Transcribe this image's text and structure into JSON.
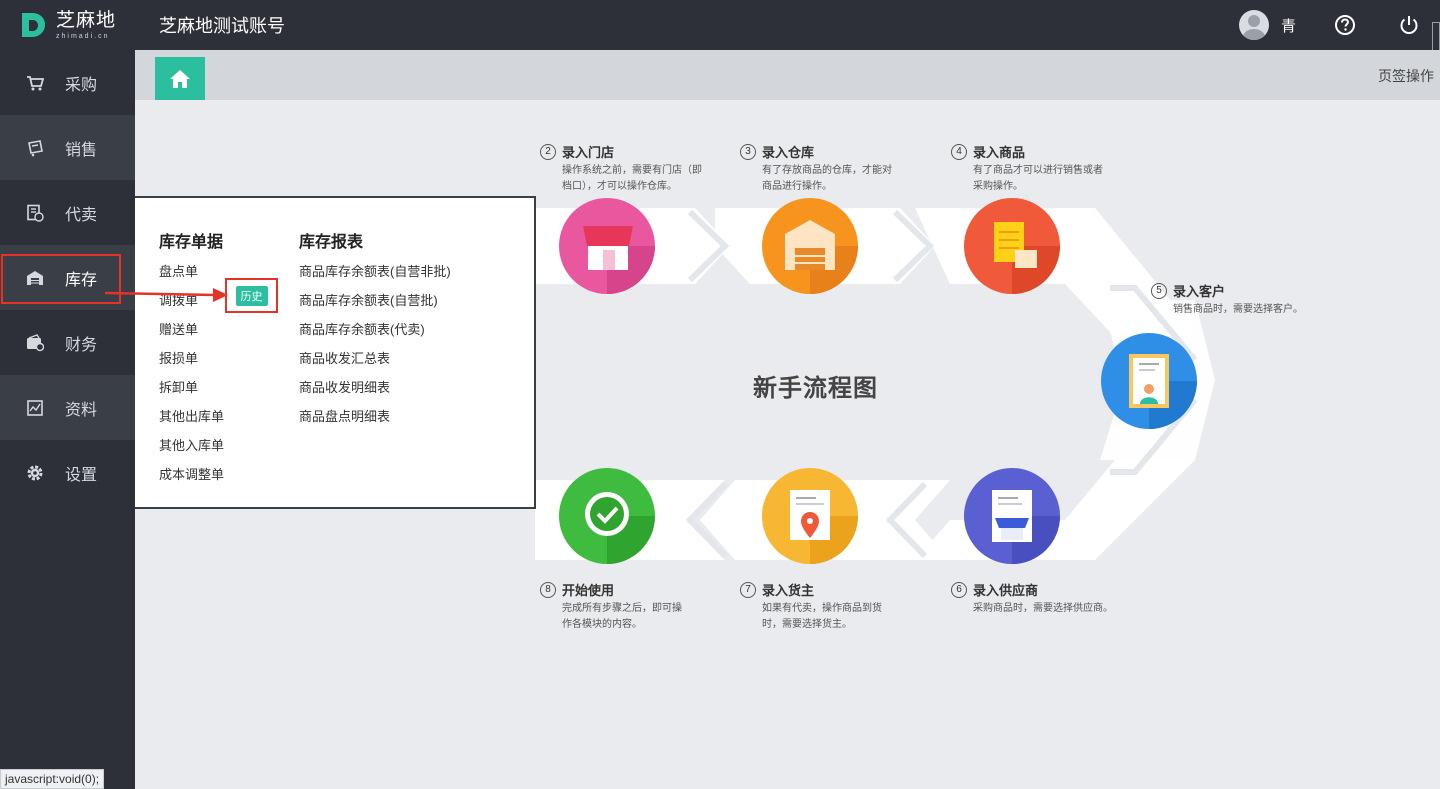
{
  "header": {
    "logo_cn": "芝麻地",
    "logo_en": "zhimadi.cn",
    "account_title": "芝麻地测试账号",
    "user_name": "青"
  },
  "sidebar": {
    "items": [
      {
        "label": "采购",
        "icon": "cart-icon"
      },
      {
        "label": "销售",
        "icon": "sales-icon"
      },
      {
        "label": "代卖",
        "icon": "consign-icon"
      },
      {
        "label": "库存",
        "icon": "warehouse-icon"
      },
      {
        "label": "财务",
        "icon": "finance-icon"
      },
      {
        "label": "资料",
        "icon": "data-icon"
      },
      {
        "label": "设置",
        "icon": "gear-icon"
      }
    ]
  },
  "tabbar": {
    "page_ops": "页签操作"
  },
  "menu": {
    "col1_title": "库存单据",
    "col1_items": [
      "盘点单",
      "调拨单",
      "赠送单",
      "报损单",
      "拆卸单",
      "其他出库单",
      "其他入库单",
      "成本调整单"
    ],
    "history_badge": "历史",
    "col2_title": "库存报表",
    "col2_items": [
      "商品库存余额表(自营非批)",
      "商品库存余额表(自营批)",
      "商品库存余额表(代卖)",
      "商品收发汇总表",
      "商品收发明细表",
      "商品盘点明细表"
    ]
  },
  "flow": {
    "center_title": "新手流程图",
    "steps": [
      {
        "num": "2",
        "title": "录入门店",
        "desc": "操作系统之前，需要有门店（即档口），才可以操作仓库。"
      },
      {
        "num": "3",
        "title": "录入仓库",
        "desc": "有了存放商品的仓库，才能对商品进行操作。"
      },
      {
        "num": "4",
        "title": "录入商品",
        "desc": "有了商品才可以进行销售或者采购操作。"
      },
      {
        "num": "5",
        "title": "录入客户",
        "desc": "销售商品时，需要选择客户。"
      },
      {
        "num": "6",
        "title": "录入供应商",
        "desc": "采购商品时，需要选择供应商。"
      },
      {
        "num": "7",
        "title": "录入货主",
        "desc": "如果有代卖，操作商品到货时，需要选择货主。"
      },
      {
        "num": "8",
        "title": "开始使用",
        "desc": "完成所有步骤之后，即可操作各模块的内容。"
      }
    ]
  },
  "status_bar": "javascript:void(0);",
  "colors": {
    "accent": "#2bbfa0",
    "sidebar_bg": "#2d3038",
    "highlight_red": "#e5332a"
  }
}
